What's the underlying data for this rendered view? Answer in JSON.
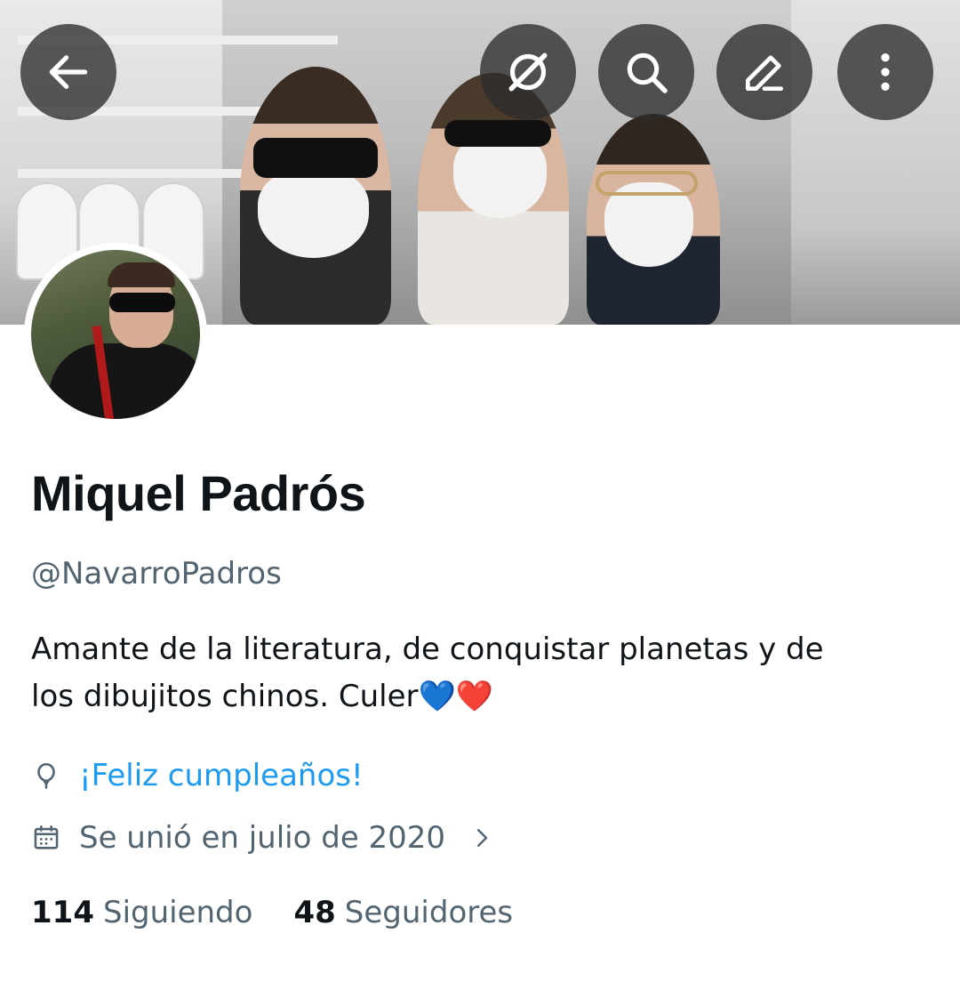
{
  "profile": {
    "name": "Miquel Padrós",
    "handle": "@NavarroPadros",
    "bio_line1": "Amante de la literatura, de conquistar planetas y de",
    "bio_line2": "los dibujitos chinos. Culer",
    "bio_emojis": [
      "💙",
      "❤️"
    ],
    "birthday_text": "¡Feliz cumpleaños!",
    "joined_text": "Se unió en julio de 2020"
  },
  "stats": {
    "following_count": "114",
    "following_label": "Siguiendo",
    "followers_count": "48",
    "followers_label": "Seguidores"
  },
  "toolbar": {
    "icons": [
      "back-arrow-icon",
      "grok-icon",
      "search-icon",
      "edit-icon",
      "more-vertical-icon"
    ]
  },
  "colors": {
    "text_primary": "#0f1419",
    "text_secondary": "#536471",
    "link_blue": "#1d9bf0",
    "button_overlay": "rgba(45,45,45,0.78)"
  }
}
